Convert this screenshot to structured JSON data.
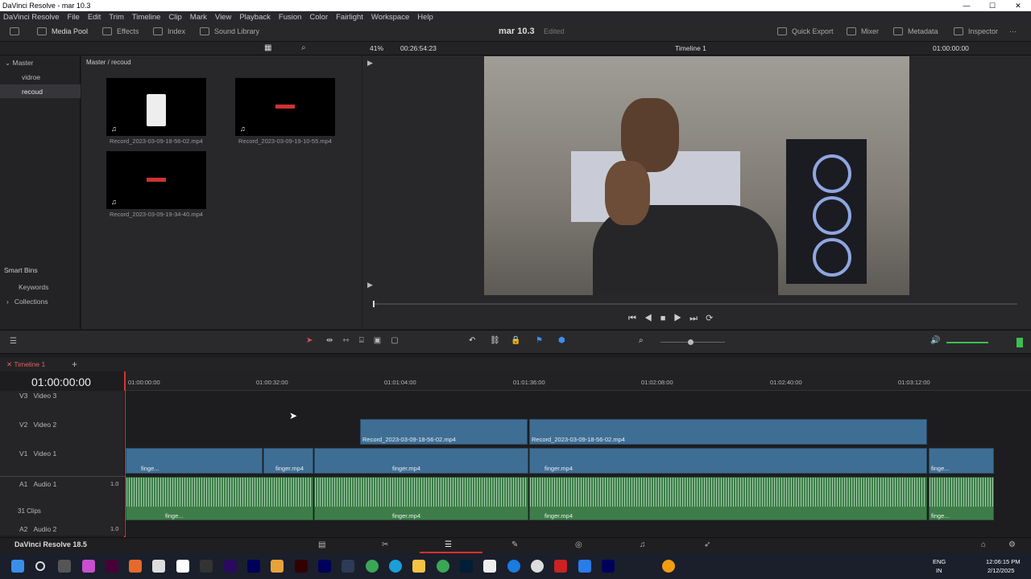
{
  "window": {
    "title": "DaVinci Resolve - mar 10.3",
    "controls": [
      "—",
      "☐",
      "✕"
    ]
  },
  "menu": [
    "DaVinci Resolve",
    "File",
    "Edit",
    "Trim",
    "Timeline",
    "Clip",
    "Mark",
    "View",
    "Playback",
    "Fusion",
    "Color",
    "Fairlight",
    "Workspace",
    "Help"
  ],
  "toolbar": {
    "media_pool": "Media Pool",
    "effects": "Effects",
    "index": "Index",
    "sound_library": "Sound Library",
    "project": "mar 10.3",
    "status": "Edited",
    "quick_export": "Quick Export",
    "mixer": "Mixer",
    "metadata": "Metadata",
    "inspector": "Inspector"
  },
  "viewer_bar": {
    "zoom": "41%",
    "duration": "00:26:54:23",
    "timeline_name": "Timeline 1",
    "timecode": "01:00:00:00"
  },
  "sidebar": {
    "master": "Master",
    "items": [
      "vidroe",
      "recoud"
    ],
    "smart_bins": "Smart Bins",
    "smart_items": [
      "Keywords",
      "Collections"
    ]
  },
  "bins": {
    "path": "Master / recoud",
    "clips": [
      "Record_2023-03-09-18-56-02.mp4",
      "Record_2023-03-09-19-10-55.mp4",
      "Record_2023-03-09-19-34-40.mp4"
    ]
  },
  "timeline": {
    "tab": "Timeline 1",
    "timecode": "01:00:00:00",
    "ruler": [
      "01:00:00:00",
      "01:00:32:00",
      "01:01:04:00",
      "01:01:36:00",
      "01:02:08:00",
      "01:02:40:00",
      "01:03:12:00"
    ],
    "tracks": [
      {
        "id": "V3",
        "name": "Video 3"
      },
      {
        "id": "V2",
        "name": "Video 2"
      },
      {
        "id": "V1",
        "name": "Video 1"
      },
      {
        "id": "A1",
        "name": "Audio 1",
        "level": "1.0",
        "clips": "31 Clips"
      },
      {
        "id": "A2",
        "name": "Audio 2",
        "level": "1.0"
      }
    ],
    "v2_clip": "Record_2023-03-09-18-56-02.mp4",
    "v1_clip": "finger.mp4",
    "v1_short": "finge..."
  },
  "taskbar": {
    "app": "DaVinci Resolve 18.5",
    "lang1": "ENG",
    "lang2": "IN",
    "time": "12:06:15 PM",
    "date": "2/12/2025"
  }
}
